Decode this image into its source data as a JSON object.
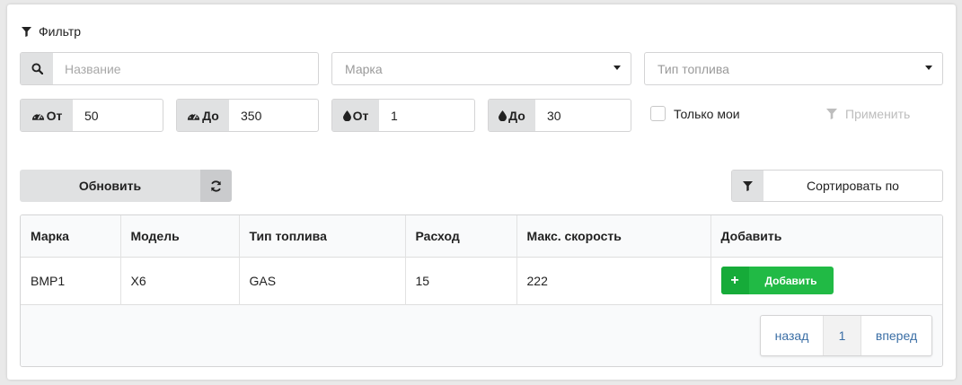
{
  "filter": {
    "title": "Фильтр",
    "name_placeholder": "Название",
    "brand_placeholder": "Марка",
    "fuel_placeholder": "Тип топлива",
    "speed_from": {
      "label": "От",
      "value": "50"
    },
    "speed_to": {
      "label": "До",
      "value": "350"
    },
    "consumption_from": {
      "label": "От",
      "value": "1"
    },
    "consumption_to": {
      "label": "До",
      "value": "30"
    },
    "only_mine_label": "Только мои",
    "apply_label": "Применить"
  },
  "toolbar": {
    "refresh_label": "Обновить",
    "sort_label": "Сортировать по"
  },
  "table": {
    "headers": [
      "Марка",
      "Модель",
      "Тип топлива",
      "Расход",
      "Макс. скорость",
      "Добавить"
    ],
    "rows": [
      {
        "brand": "BMP1",
        "model": "X6",
        "fuel": "GAS",
        "consumption": "15",
        "max_speed": "222",
        "add_label": "Добавить"
      }
    ]
  },
  "pagination": {
    "prev_label": "назад",
    "current_page": "1",
    "next_label": "вперед"
  },
  "colors": {
    "add_button": "#21ba45",
    "link": "#3a6ea5"
  }
}
